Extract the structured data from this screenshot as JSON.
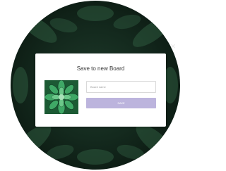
{
  "modal": {
    "title": "Save to new Board",
    "board_name_placeholder": "Board name",
    "save_label": "SAVE",
    "close_glyph": "×"
  },
  "icons": {
    "close": "close-icon"
  },
  "colors": {
    "backdrop": "#142a1e",
    "save_button": "#bcb4dd",
    "save_text": "#ffffff",
    "thumbnail": "#1c6a3a"
  }
}
